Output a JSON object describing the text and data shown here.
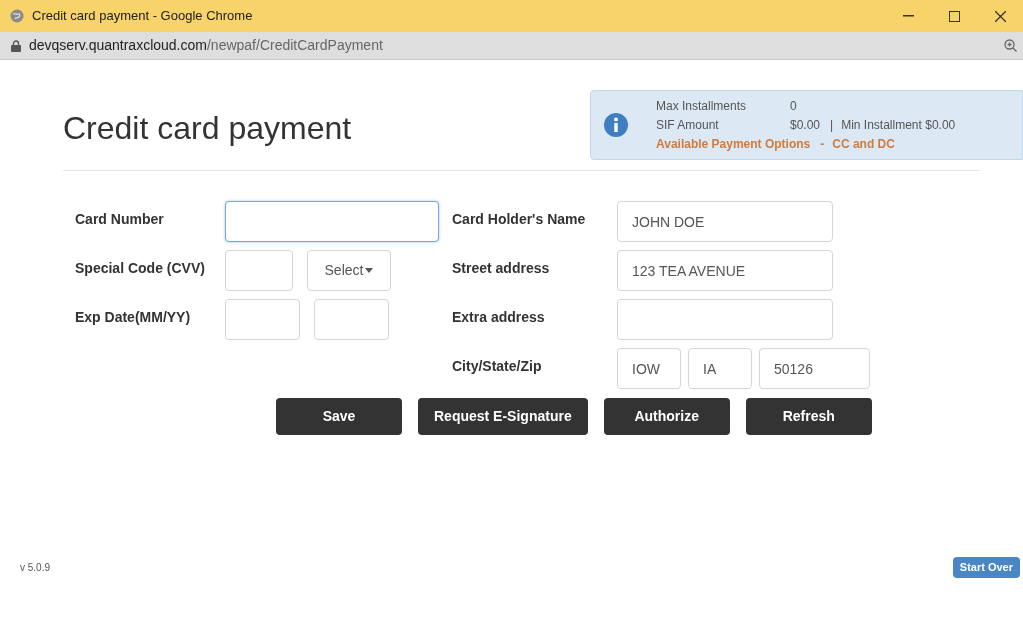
{
  "window": {
    "title": "Credit card payment - Google Chrome"
  },
  "address_bar": {
    "host": "devqserv.quantraxcloud.com",
    "path": "/newpaf/CreditCardPayment"
  },
  "page_title": "Credit card payment",
  "info": {
    "max_installments_label": "Max Installments",
    "max_installments": "0",
    "sif_label": "SIF Amount",
    "sif": "$0.00",
    "separator": "|",
    "min_label": "Min Installment",
    "min": "$0.00",
    "options_label": "Available Payment Options",
    "options_dash": "-",
    "options": "CC and DC"
  },
  "form_left": [
    {
      "label": "Card Number",
      "fields": [
        {
          "kind": "input",
          "focused": true
        }
      ]
    },
    {
      "label": "Special Code (CVV)",
      "fields": [
        {
          "kind": "input",
          "focused": false
        },
        {
          "kind": "select",
          "value": "Select",
          "focused": false
        }
      ]
    },
    {
      "label": "Exp Date(MM/YY)",
      "fields": [
        {
          "kind": "input",
          "focused": false
        },
        {
          "kind": "input",
          "focused": false
        }
      ]
    }
  ],
  "form_right": [
    {
      "label": "Card Holder's Name",
      "fields": [
        {
          "kind": "input",
          "value": "JOHN DOE",
          "focused": false
        }
      ]
    },
    {
      "label": "Street address",
      "fields": [
        {
          "kind": "input",
          "value": "123 TEA AVENUE",
          "focused": false
        }
      ]
    },
    {
      "label": "Extra address",
      "fields": [
        {
          "kind": "input",
          "focused": false
        }
      ]
    },
    {
      "label": "City/State/Zip",
      "fields": [
        {
          "kind": "input",
          "value": "IOW",
          "focused": false
        },
        {
          "kind": "input",
          "value": "IA",
          "focused": false
        },
        {
          "kind": "input",
          "value": "50126",
          "focused": false
        }
      ]
    }
  ],
  "buttons": [
    "Save",
    "Request E-Signature",
    "Authorize",
    "Refresh"
  ],
  "version": "v 5.0.9",
  "start_over": "Start Over"
}
